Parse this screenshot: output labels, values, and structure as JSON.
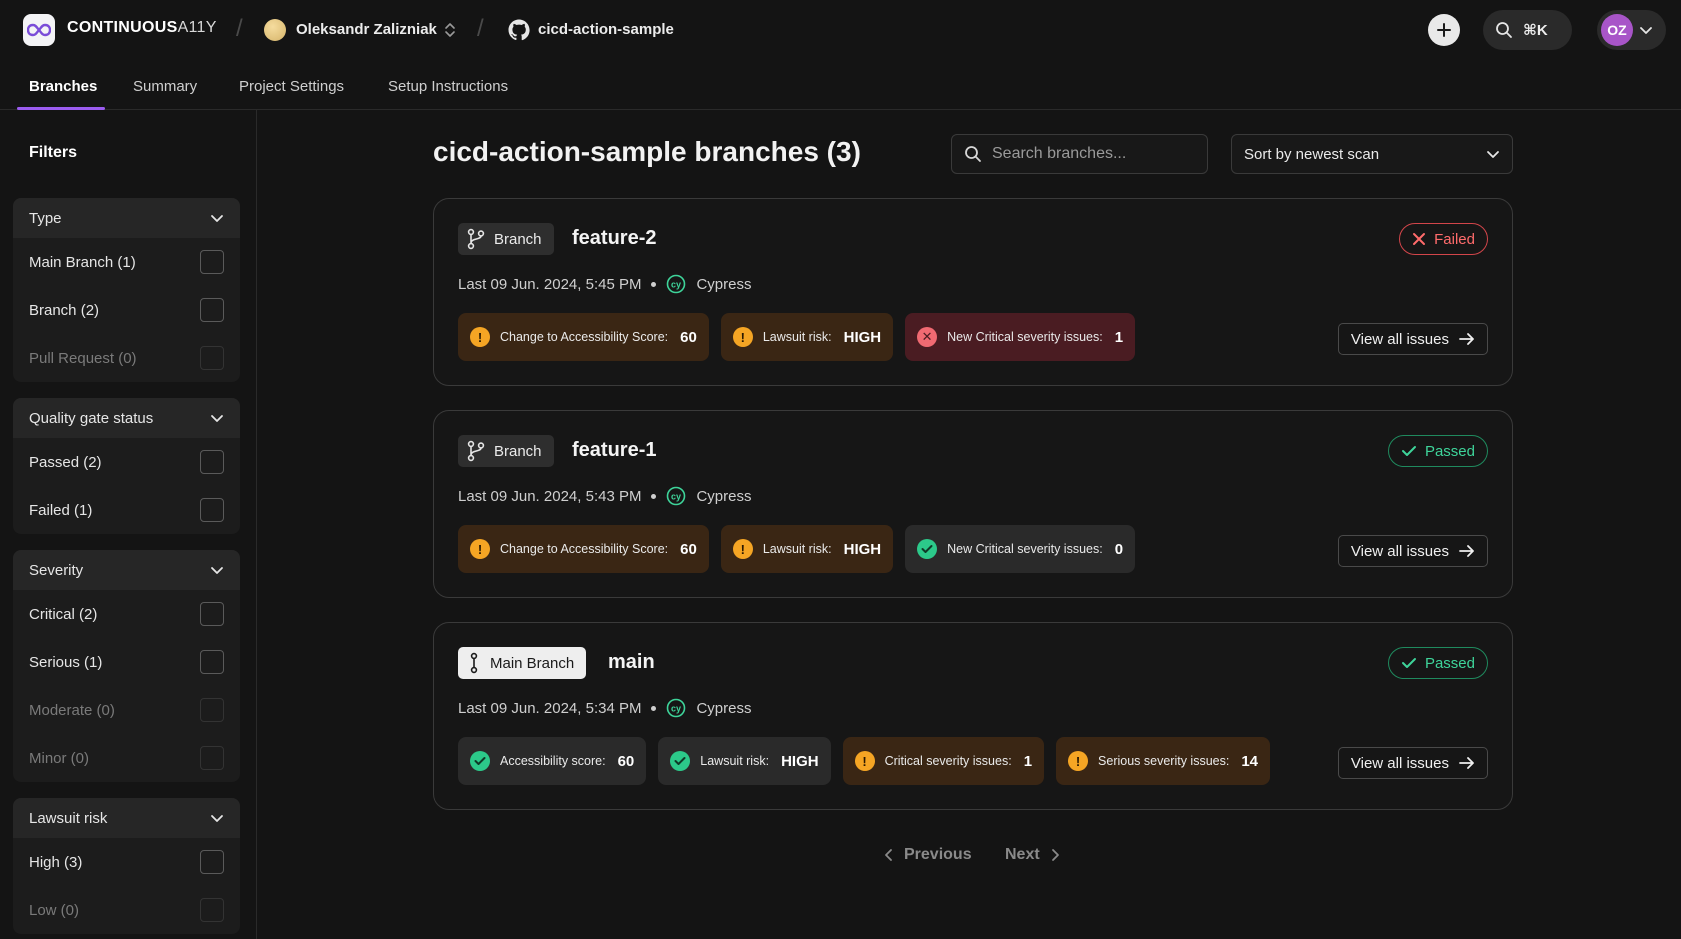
{
  "header": {
    "brand_bold": "CONTINUOUS",
    "brand_light": "A11Y",
    "user_name": "Oleksandr Zalizniak",
    "repo_name": "cicd-action-sample",
    "search_shortcut": "⌘K",
    "avatar_initials": "OZ"
  },
  "tabs": [
    {
      "label": "Branches",
      "active": true
    },
    {
      "label": "Summary",
      "active": false
    },
    {
      "label": "Project Settings",
      "active": false
    },
    {
      "label": "Setup Instructions",
      "active": false
    }
  ],
  "sidebar": {
    "title": "Filters",
    "groups": [
      {
        "title": "Type",
        "options": [
          {
            "label": "Main Branch (1)",
            "enabled": true
          },
          {
            "label": "Branch (2)",
            "enabled": true
          },
          {
            "label": "Pull Request (0)",
            "enabled": false
          }
        ]
      },
      {
        "title": "Quality gate status",
        "options": [
          {
            "label": "Passed (2)",
            "enabled": true
          },
          {
            "label": "Failed (1)",
            "enabled": true
          }
        ]
      },
      {
        "title": "Severity",
        "options": [
          {
            "label": "Critical (2)",
            "enabled": true
          },
          {
            "label": "Serious (1)",
            "enabled": true
          },
          {
            "label": "Moderate (0)",
            "enabled": false
          },
          {
            "label": "Minor (0)",
            "enabled": false
          }
        ]
      },
      {
        "title": "Lawsuit risk",
        "options": [
          {
            "label": "High (3)",
            "enabled": true
          },
          {
            "label": "Low (0)",
            "enabled": false
          }
        ]
      }
    ]
  },
  "main": {
    "title": "cicd-action-sample branches (3)",
    "search_placeholder": "Search branches...",
    "sort_label": "Sort by newest scan",
    "view_all_label": "View all issues",
    "pager": {
      "previous": "Previous",
      "next": "Next"
    },
    "branches": [
      {
        "type_label": "Branch",
        "name": "feature-2",
        "status": "Failed",
        "last_scan": "Last 09 Jun. 2024, 5:45 PM",
        "tool": "Cypress",
        "metrics": [
          {
            "label": "Change to Accessibility Score:",
            "value": "60",
            "tone": "warn"
          },
          {
            "label": "Lawsuit risk:",
            "value": "HIGH",
            "tone": "warn"
          },
          {
            "label": "New Critical severity issues:",
            "value": "1",
            "tone": "bad"
          }
        ]
      },
      {
        "type_label": "Branch",
        "name": "feature-1",
        "status": "Passed",
        "last_scan": "Last 09 Jun. 2024, 5:43 PM",
        "tool": "Cypress",
        "metrics": [
          {
            "label": "Change to Accessibility Score:",
            "value": "60",
            "tone": "warn"
          },
          {
            "label": "Lawsuit risk:",
            "value": "HIGH",
            "tone": "warn"
          },
          {
            "label": "New Critical severity issues:",
            "value": "0",
            "tone": "ok"
          }
        ]
      },
      {
        "type_label": "Main Branch",
        "name": "main",
        "status": "Passed",
        "last_scan": "Last 09 Jun. 2024, 5:34 PM",
        "tool": "Cypress",
        "metrics": [
          {
            "label": "Accessibility score:",
            "value": "60",
            "tone": "ok"
          },
          {
            "label": "Lawsuit risk:",
            "value": "HIGH",
            "tone": "ok"
          },
          {
            "label": "Critical severity issues:",
            "value": "1",
            "tone": "warn"
          },
          {
            "label": "Serious severity issues:",
            "value": "14",
            "tone": "warn"
          }
        ]
      }
    ]
  },
  "colors": {
    "accent": "#9b5cf0",
    "failed": "#ff6b6b",
    "passed": "#3ed49a",
    "warning": "#f5a524"
  }
}
